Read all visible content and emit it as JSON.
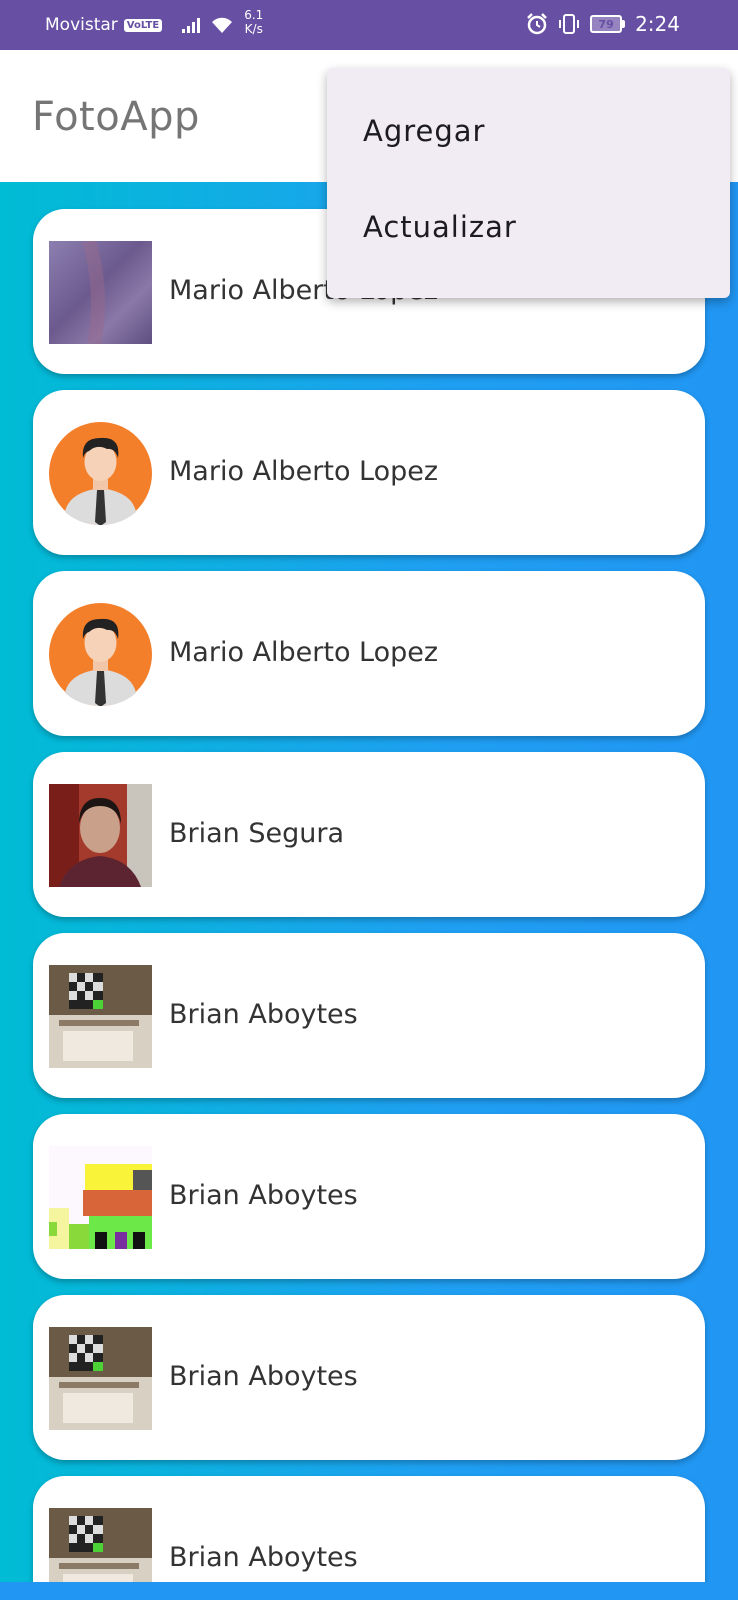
{
  "status_bar": {
    "carrier": "Movistar",
    "volte_badge": "VoLTE",
    "net_speed_value": "6.1",
    "net_speed_unit": "K/s",
    "battery_level": "79",
    "time": "2:24"
  },
  "app_bar": {
    "title": "FotoApp"
  },
  "menu": {
    "items": [
      {
        "label": "Agregar"
      },
      {
        "label": "Actualizar"
      }
    ]
  },
  "contacts": [
    {
      "name": "Mario Alberto Lopez",
      "photo": "purple-blur-photo"
    },
    {
      "name": "Mario Alberto Lopez",
      "photo": "default-avatar-icon"
    },
    {
      "name": "Mario Alberto Lopez",
      "photo": "default-avatar-icon"
    },
    {
      "name": "Brian Segura",
      "photo": "person-selfie-photo"
    },
    {
      "name": "Brian Aboytes",
      "photo": "room-photo"
    },
    {
      "name": "Brian Aboytes",
      "photo": "pixel-drawing-photo"
    },
    {
      "name": "Brian Aboytes",
      "photo": "room-photo"
    },
    {
      "name": "Brian Aboytes",
      "photo": "room-photo"
    }
  ],
  "colors": {
    "status_bar": "#6750a4",
    "list_gradient_start": "#00bcd4",
    "list_gradient_end": "#2196f3",
    "menu_background": "#f1ecf4"
  }
}
